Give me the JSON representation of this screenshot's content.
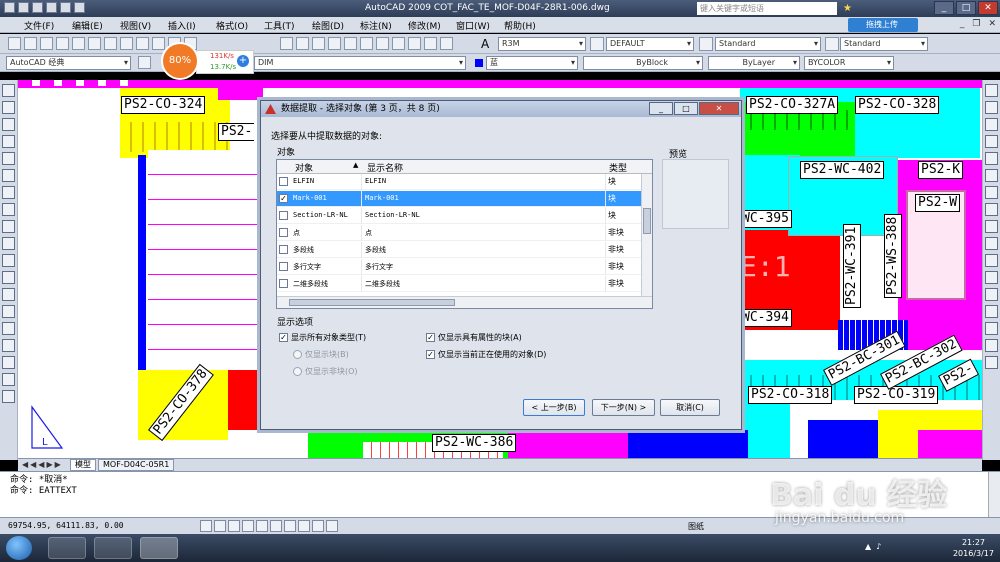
{
  "window": {
    "title": "AutoCAD 2009 COT_FAC_TE_MOF-D04F-28R1-006.dwg",
    "search_placeholder": "键入关键字或短语"
  },
  "menu": {
    "items": [
      "文件(F)",
      "编辑(E)",
      "视图(V)",
      "插入(I)",
      "格式(O)",
      "工具(T)",
      "绘图(D)",
      "标注(N)",
      "修改(M)",
      "窗口(W)",
      "帮助(H)"
    ],
    "upload_label": "拖拽上传"
  },
  "toolbar": {
    "workspace": "AutoCAD 经典",
    "text_style": "R3M",
    "dim_style": "DEFAULT",
    "table_style": "Standard",
    "multileader_style": "Standard",
    "dim_layer": "DIM",
    "color": "蓝",
    "linetype": "ByBlock",
    "lineweight": "ByLayer",
    "plotstyle": "BYCOLOR"
  },
  "netwidget": {
    "percent": "80%",
    "up": "131K/s",
    "down": "13.7K/s"
  },
  "drawing": {
    "labels": [
      "PS2-CO-324",
      "PS2-",
      "PS2-CO-327A",
      "PS2-CO-328",
      "PS2-WC-402",
      "PS2-K",
      "PS2-W",
      "WC-395",
      "E:1",
      "WC-394",
      "PS2-CO-318",
      "PS2-CO-319",
      "PS2-WC-386"
    ],
    "vertical_labels": [
      "PS2-WC-391",
      "PS2-WS-388"
    ],
    "rotated_labels": [
      "PS2-CO-378",
      "PS2-BC-301",
      "PS2-BC-302",
      "PS2-"
    ]
  },
  "layout_tabs": {
    "model": "模型",
    "layout": "MOF-D04C-05R1"
  },
  "command": {
    "lines": [
      "命令: *取消*",
      "命令: EATTEXT"
    ]
  },
  "status": {
    "coords": "69754.95, 64111.83, 0.00",
    "paper": "图纸"
  },
  "taskbar": {
    "time": "21:27",
    "date": "2016/3/17"
  },
  "watermark": {
    "brand": "Bai du 经验",
    "url": "jingyan.baidu.com"
  },
  "dialog": {
    "title": "数据提取 - 选择对象 (第 3 页，共 8 页)",
    "prompt": "选择要从中提取数据的对象:",
    "objects_group": "对象",
    "preview_group": "预览",
    "columns": [
      "对象",
      "显示名称",
      "类型"
    ],
    "rows": [
      {
        "object": "ELFIN",
        "display": "ELFIN",
        "type": "块",
        "checked": false,
        "selected": false
      },
      {
        "object": "Mark-001",
        "display": "Mark-001",
        "type": "块",
        "checked": true,
        "selected": true
      },
      {
        "object": "Section-LR-NL",
        "display": "Section-LR-NL",
        "type": "块",
        "checked": false,
        "selected": false
      },
      {
        "object": "点",
        "display": "点",
        "type": "非块",
        "checked": false,
        "selected": false
      },
      {
        "object": "多段线",
        "display": "多段线",
        "type": "非块",
        "checked": false,
        "selected": false
      },
      {
        "object": "多行文字",
        "display": "多行文字",
        "type": "非块",
        "checked": false,
        "selected": false
      },
      {
        "object": "二维多段线",
        "display": "二维多段线",
        "type": "非块",
        "checked": false,
        "selected": false
      }
    ],
    "display_options_title": "显示选项",
    "options": {
      "show_all_types": "显示所有对象类型(T)",
      "only_blocks": "仅显示块(B)",
      "only_nonblocks": "仅显示非块(O)",
      "show_attr_blocks": "仅显示具有属性的块(A)",
      "show_in_use": "仅显示当前正在使用的对象(D)"
    },
    "buttons": {
      "back": "< 上一步(B)",
      "next": "下一步(N) >",
      "cancel": "取消(C)"
    }
  }
}
